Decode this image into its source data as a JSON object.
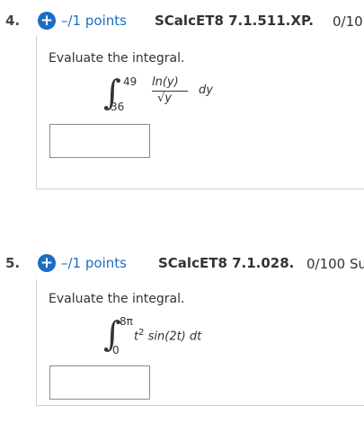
{
  "questions": [
    {
      "number": "4.",
      "points": "–/1 points",
      "code": "SCalcET8 7.1.511.XP.",
      "score": "0/10",
      "prompt": "Evaluate the integral.",
      "upper": "49",
      "lower": "36",
      "numerator": "ln(y)",
      "denominator": "√y",
      "differential": "dy"
    },
    {
      "number": "5.",
      "points": "–/1 points",
      "code": "SCalcET8 7.1.028.",
      "score": "0/100 Su",
      "prompt": "Evaluate the integral.",
      "upper": "8π",
      "lower": "0",
      "integrand_base": "t",
      "integrand_exp": "2",
      "integrand_rest": " sin(2t) dt"
    }
  ],
  "icons": {
    "plus": "+"
  }
}
